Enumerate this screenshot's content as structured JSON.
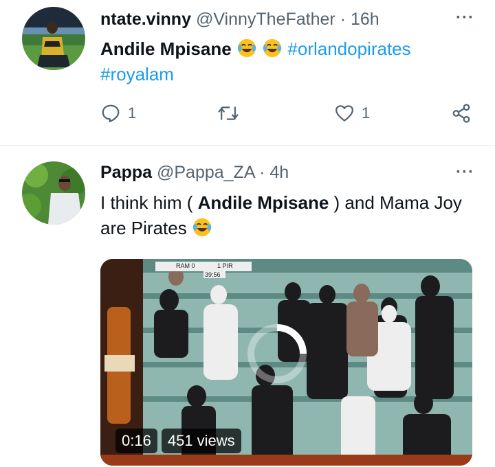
{
  "tweets": [
    {
      "display_name": "ntate.vinny",
      "handle": "@VinnyTheFather",
      "separator": "·",
      "time": "16h",
      "text_bold": "Andile Mpisane",
      "hashtags": [
        "#orlandopirates",
        "#royalam"
      ],
      "replies": "1",
      "likes": "1"
    },
    {
      "display_name": "Pappa",
      "handle": "@Pappa_ZA",
      "separator": "·",
      "time": "4h",
      "text_pre": "I think him ( ",
      "text_bold": "Andile Mpisane",
      "text_post": " ) and Mama Joy are Pirates",
      "video": {
        "duration": "0:16",
        "views": "451 views",
        "scoreboard": {
          "home": "RAM",
          "home_score": "0",
          "away": "PIR",
          "away_score": "1",
          "clock": "39:56"
        }
      }
    }
  ],
  "icons": {
    "reply": "reply-icon",
    "retweet": "retweet-icon",
    "like": "heart-icon",
    "share": "share-icon",
    "more": "more-icon",
    "emoji": "laughing-crying-emoji"
  },
  "colors": {
    "link": "#1d9bf0",
    "muted": "#536471"
  }
}
